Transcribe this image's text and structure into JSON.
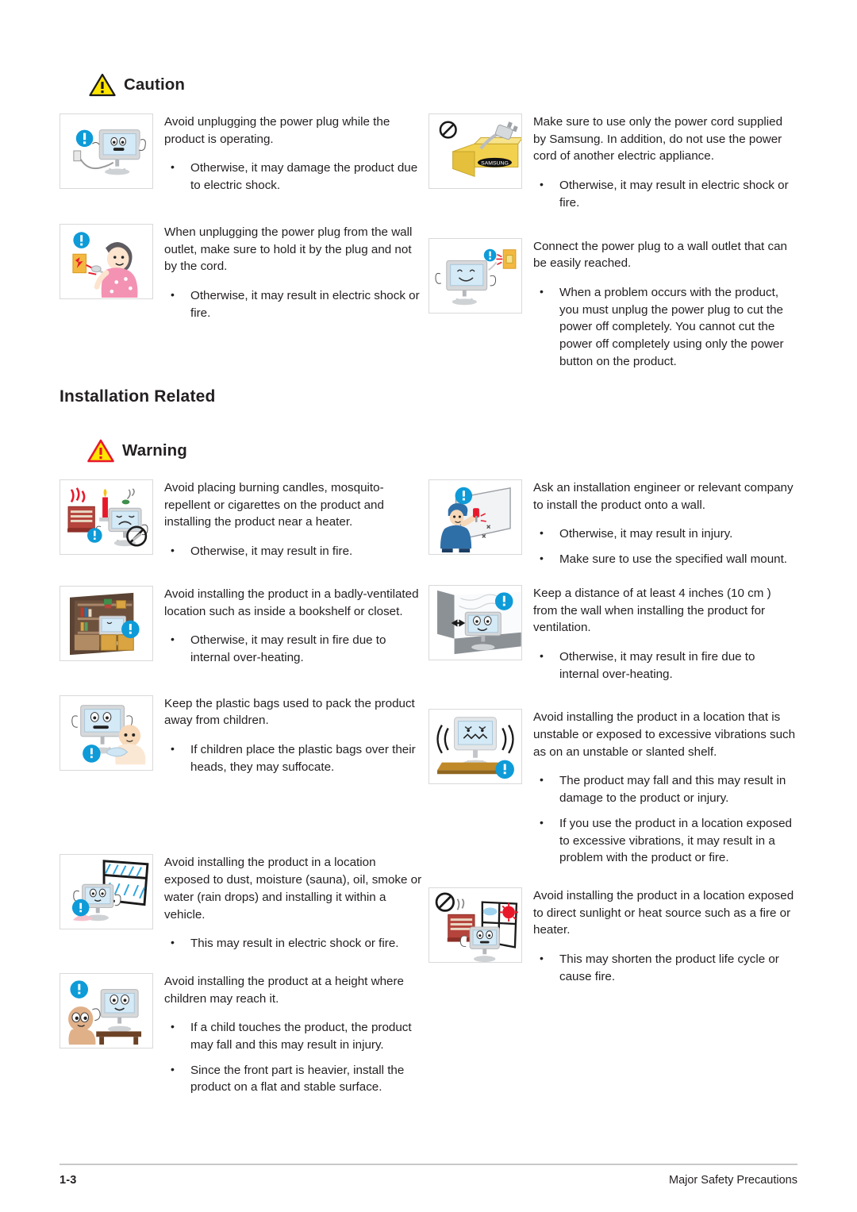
{
  "page": {
    "footer_page_number": "1-3",
    "footer_title": "Major Safety Precautions"
  },
  "colors": {
    "caution_triangle_fill": "#ffe500",
    "caution_triangle_stroke": "#1a1a1a",
    "warning_triangle_fill": "#ffe500",
    "warning_triangle_stroke": "#e8182b",
    "info_badge_blue": "#0e9bd8",
    "text": "#231f20",
    "thumb_border": "#d9d9d9",
    "footer_rule": "#c9c9c9"
  },
  "caution_section": {
    "heading": "Caution",
    "heading_icon": "caution-triangle-icon",
    "left_items": [
      {
        "image": "monitor-unplug-icon",
        "lead": "Avoid unplugging the power plug while the product is operating.",
        "bullets": [
          "Otherwise, it may damage the product due to electric shock."
        ]
      },
      {
        "image": "woman-pulling-cord-icon",
        "lead": "When unplugging the power plug from the wall outlet, make sure to hold it by the plug and not by the cord.",
        "bullets": [
          "Otherwise, it may result in electric shock or fire."
        ]
      }
    ],
    "right_items": [
      {
        "image": "samsung-box-power-cord-icon",
        "lead": "Make sure to use only the power cord supplied by Samsung. In addition, do not use the power cord of another electric appliance.",
        "bullets": [
          "Otherwise, it may result in electric shock or fire."
        ]
      },
      {
        "image": "monitor-wall-outlet-icon",
        "lead": "Connect the power plug to a wall outlet that can be easily reached.",
        "bullets": [
          "When a problem occurs with the product, you must unplug the power plug to cut the power off completely. You cannot cut the power off completely using only the power button on the product."
        ]
      }
    ]
  },
  "installation_section": {
    "title": "Installation Related",
    "heading": "Warning",
    "heading_icon": "warning-triangle-icon",
    "left_items": [
      {
        "image": "heater-candle-cigarette-icon",
        "lead": "Avoid placing burning candles,  mosquito-repellent or cigarettes on the product and installing the product near a heater.",
        "bullets": [
          "Otherwise, it may result in fire."
        ]
      },
      {
        "image": "bookshelf-monitor-icon",
        "lead": "Avoid installing the product in a badly-ventilated location such as inside a bookshelf or closet.",
        "bullets": [
          "Otherwise, it may result in fire due to internal over-heating."
        ]
      },
      {
        "image": "baby-plastic-bag-icon",
        "lead": "Keep the plastic bags used to pack the product away from children.",
        "bullets": [
          " If children place the plastic bags over their heads, they may suffocate."
        ]
      },
      {
        "image": "rain-window-monitor-icon",
        "lead": "Avoid installing the product in a location exposed to dust, moisture (sauna), oil, smoke or water (rain drops) and installing it within a vehicle.",
        "bullets": [
          "This may result in electric shock or fire."
        ]
      },
      {
        "image": "child-reaching-monitor-icon",
        "lead": "Avoid installing the product at a height where children may reach it.",
        "bullets": [
          "If a child touches the product, the product may fall and this may result in injury.",
          "Since the front part is heavier, install the product on a flat and stable surface."
        ]
      }
    ],
    "right_items": [
      {
        "image": "wall-mount-installer-icon",
        "lead": "Ask an installation engineer or relevant company to install the product onto a wall.",
        "bullets": [
          "Otherwise, it may result in injury.",
          "Make sure to use the specified wall mount."
        ]
      },
      {
        "image": "wall-distance-monitor-icon",
        "lead": "Keep a distance of at least 4 inches (10 cm  ) from the wall when installing the product for ventilation.",
        "bullets": [
          "Otherwise, it may result in fire due to internal over-heating."
        ]
      },
      {
        "image": "vibrating-monitor-shelf-icon",
        "lead": "Avoid installing the product in a location that is unstable or exposed to excessive vibrations such as on an unstable or slanted shelf.",
        "bullets": [
          "The product may fall and this may result in damage to the product or injury.",
          "If you use the product in a location exposed to excessive vibrations, it may result in a problem with the product or fire."
        ]
      },
      {
        "image": "sunlight-heater-monitor-icon",
        "lead": "Avoid installing the product in a location exposed to direct sunlight or heat source such as a fire or heater.",
        "bullets": [
          "This may shorten the product life cycle or cause fire."
        ]
      }
    ]
  }
}
